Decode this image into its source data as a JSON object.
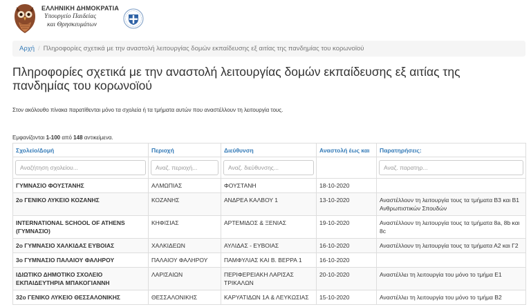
{
  "header": {
    "line1": "ΕΛΛΗΝΙΚΗ ΔΗΜΟΚΡΑΤΙΑ",
    "line2": "Υπουργείο Παιδείας",
    "line3": "και Θρησκευμάτων"
  },
  "breadcrumb": {
    "home": "Αρχή",
    "current": "Πληροφορίες σχετικά με την αναστολή λειτουργίας δομών εκπαίδευσης εξ αιτίας της πανδημίας του κορωνοϊού"
  },
  "page": {
    "title": "Πληροφορίες σχετικά με την αναστολή λειτουργίας δομών εκπαίδευσης εξ αιτίας της πανδημίας του κορωνοϊού",
    "intro": "Στον ακόλουθο πίνακα παρατίθενται μόνο τα σχολεία ή τα τμήματα αυτών που αναστέλλουν τη λειτουργία τους."
  },
  "summary": {
    "prefix": "Εμφανίζονται ",
    "range": "1-100",
    "middle": " από ",
    "total": "148",
    "suffix": " αντικείμενα."
  },
  "table": {
    "headers": {
      "school": "Σχολείο/Δομή",
      "region": "Περιοχή",
      "address": "Διεύθυνση",
      "until": "Αναστολή έως και",
      "notes": "Παρατηρήσεις:"
    },
    "filters": {
      "school": "Αναζήτηση σχολείου...",
      "region": "Αναζ. περιοχή...",
      "address": "Αναζ. διεύθυνσης...",
      "notes": "Αναζ. παρατηρ..."
    },
    "rows": [
      {
        "school": "ΓΥΜΝΑΣΙΟ ΦΟΥΣΤΑΝΗΣ",
        "region": "ΑΛΜΩΠΙΑΣ",
        "address": "ΦΟΥΣΤΑΝΗ",
        "until": "18-10-2020",
        "notes": ""
      },
      {
        "school": "2ο ΓΕΝΙΚΟ ΛΥΚΕΙΟ ΚΟΖΑΝΗΣ",
        "region": "ΚΟΖΑΝΗΣ",
        "address": "ΑΝΔΡΕΑ ΚΑΛΒΟΥ 1",
        "until": "13-10-2020",
        "notes": "Αναστέλλουν τη λειτουργία τους τα τμήματα Β3 και Β1 Ανθρωπιστικών Σπουδών"
      },
      {
        "school": "INTERNATIONAL SCHOOL OF ATHENS (ΓΥΜΝΑΣΙΟ)",
        "region": "ΚΗΦΙΣΙΑΣ",
        "address": "ΑΡΤΕΜΙΔΟΣ & ΞΕΝΙΑΣ",
        "until": "19-10-2020",
        "notes": "Αναστέλλουν τη λειτουργία τους τα τμήματα 8a, 8b και 8c"
      },
      {
        "school": "2ο ΓΥΜΝΑΣΙΟ ΧΑΛΚΙΔΑΣ ΕΥΒΟΙΑΣ",
        "region": "ΧΑΛΚΙΔΕΩΝ",
        "address": "ΑΥΛΙΔΑΣ - ΕΥΒΟΙΑΣ",
        "until": "16-10-2020",
        "notes": "Αναστέλλουν τη λειτουργία τους τα τμήματα Α2 και Γ2"
      },
      {
        "school": "3ο ΓΥΜΝΑΣΙΟ ΠΑΛΑΙΟΥ ΦΑΛΗΡΟΥ",
        "region": "ΠΑΛΑΙΟΥ ΦΑΛΗΡΟΥ",
        "address": "ΠΑΜΦΥΛΙΑΣ ΚΑΙ Β. ΒΕΡΡΑ 1",
        "until": "16-10-2020",
        "notes": ""
      },
      {
        "school": "ΙΔΙΩΤΙΚΟ ΔΗΜΟΤΙΚΟ ΣΧΟΛΕΙΟ ΕΚΠΑΙΔΕΥΤΗΡΙΑ ΜΠΑΚΟΓΙΑΝΝΗ",
        "region": "ΛΑΡΙΣΑΙΩΝ",
        "address": "ΠΕΡΙΦΕΡΕΙΑΚΗ ΛΑΡΙΣΑΣ ΤΡΙΚΑΛΩΝ",
        "until": "20-10-2020",
        "notes": "Αναστέλλει τη λειτουργία του μόνο το τμήμα Ε1"
      },
      {
        "school": "32ο ΓΕΝΙΚΟ ΛΥΚΕΙΟ ΘΕΣΣΑΛΟΝΙΚΗΣ",
        "region": "ΘΕΣΣΑΛΟΝΙΚΗΣ",
        "address": "ΚΑΡΥΑΤΙΔΩΝ 1Α & ΛΕΥΚΩΣΙΑΣ",
        "until": "15-10-2020",
        "notes": "Αναστέλλει τη λειτουργία του μόνο το τμήμα Β2"
      }
    ]
  }
}
